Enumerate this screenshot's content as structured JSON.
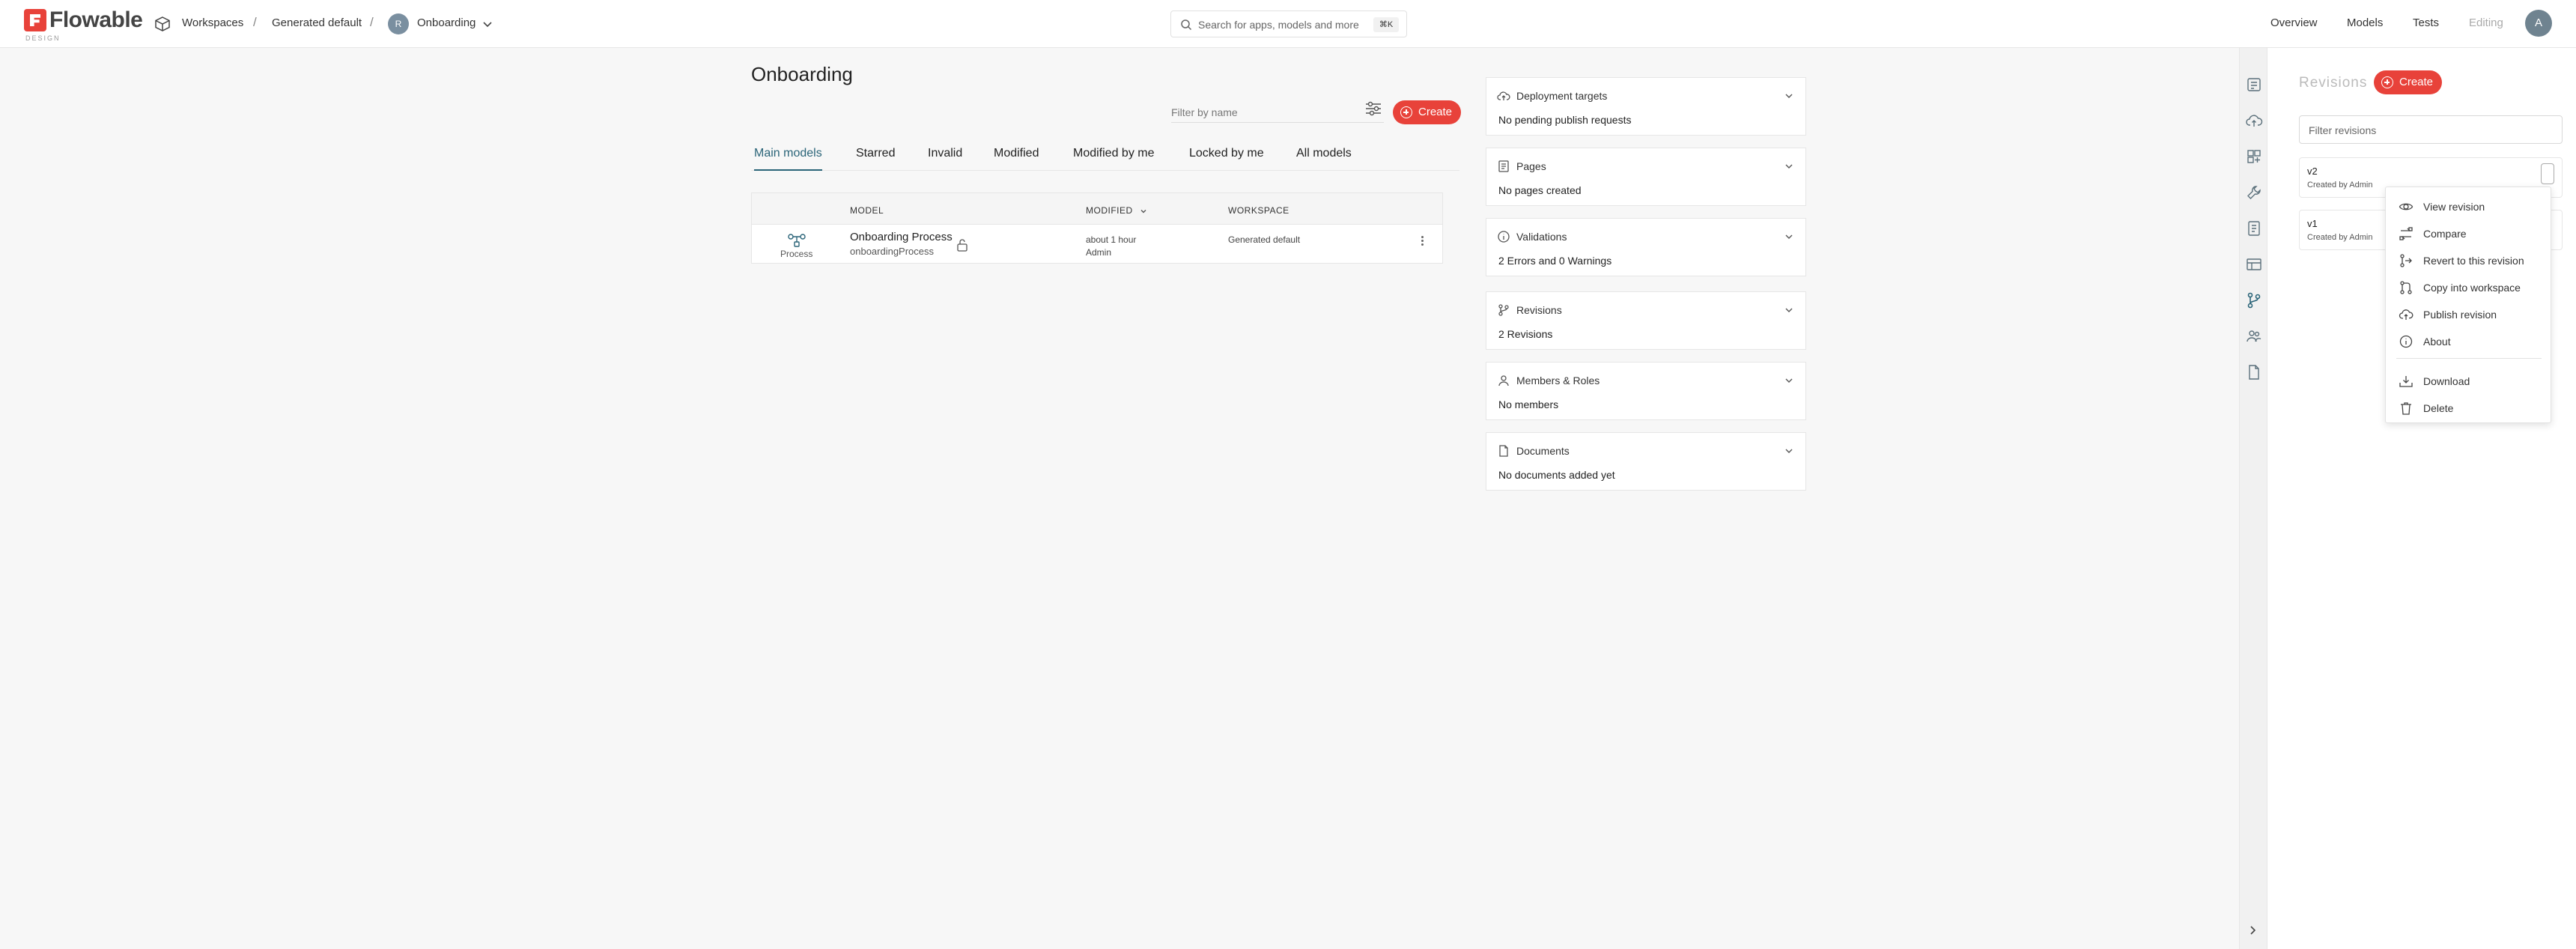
{
  "brand": {
    "name": "Flowable",
    "sub": "DESIGN",
    "accent": "#e8423a"
  },
  "header": {
    "breadcrumbs": [
      "Workspaces",
      "Generated default",
      "Onboarding"
    ],
    "app_avatar": "R",
    "search_placeholder": "Search for apps, models and more",
    "search_shortcut": "⌘K",
    "nav": [
      "Overview",
      "Models",
      "Tests",
      "Editing"
    ],
    "user_avatar": "A"
  },
  "main": {
    "title": "Onboarding",
    "filter_placeholder": "Filter by name",
    "create_label": "Create",
    "tabs": [
      "Main models",
      "Starred",
      "Invalid",
      "Modified",
      "Modified by me",
      "Locked by me",
      "All models"
    ],
    "active_tab": "Main models",
    "table": {
      "columns": [
        "MODEL",
        "MODIFIED",
        "WORKSPACE"
      ],
      "rows": [
        {
          "type": "Process",
          "name": "Onboarding Process",
          "key": "onboardingProcess",
          "modified": "about 1 hour",
          "modified_by": "Admin",
          "workspace": "Generated default"
        }
      ]
    }
  },
  "cards": [
    {
      "icon": "cloud-upload-icon",
      "title": "Deployment targets",
      "body": "No pending publish requests"
    },
    {
      "icon": "pages-icon",
      "title": "Pages",
      "body": "No pages created"
    },
    {
      "icon": "info-circle-icon",
      "title": "Validations",
      "body": "2 Errors and 0 Warnings"
    },
    {
      "icon": "git-branch-icon",
      "title": "Revisions",
      "body": "2 Revisions"
    },
    {
      "icon": "user-icon",
      "title": "Members & Roles",
      "body": "No members"
    },
    {
      "icon": "document-icon",
      "title": "Documents",
      "body": "No documents added yet"
    }
  ],
  "revisions_panel": {
    "title": "Revisions",
    "create_label": "Create",
    "filter_placeholder": "Filter revisions",
    "items": [
      {
        "version": "v2",
        "created_by": "Created by Admin"
      },
      {
        "version": "v1",
        "created_by": "Created by Admin"
      }
    ],
    "menu": [
      {
        "icon": "eye-icon",
        "label": "View revision"
      },
      {
        "icon": "compare-icon",
        "label": "Compare"
      },
      {
        "icon": "revert-icon",
        "label": "Revert to this revision"
      },
      {
        "icon": "copy-branch-icon",
        "label": "Copy into workspace"
      },
      {
        "icon": "cloud-upload-icon",
        "label": "Publish revision"
      },
      {
        "icon": "info-icon",
        "label": "About"
      },
      {
        "icon": "download-icon",
        "label": "Download"
      },
      {
        "icon": "trash-icon",
        "label": "Delete"
      }
    ]
  }
}
